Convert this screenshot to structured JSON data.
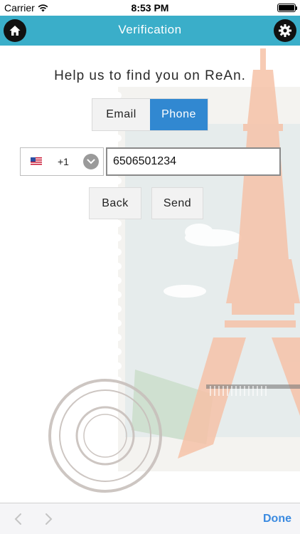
{
  "status_bar": {
    "carrier": "Carrier",
    "time": "8:53 PM",
    "battery_level": 1.0
  },
  "nav": {
    "title": "Verification",
    "left_icon": "home-icon",
    "right_icon": "gear-icon",
    "bar_color": "#3aaec9"
  },
  "main": {
    "headline": "Help us to find you on ReAn.",
    "segments": [
      {
        "label": "Email",
        "selected": false
      },
      {
        "label": "Phone",
        "selected": true
      }
    ],
    "selected_color": "#3188d1",
    "country": {
      "flag_icon": "us-flag-icon",
      "dial_code": "+1"
    },
    "phone": {
      "value": "6506501234"
    },
    "buttons": {
      "back": "Back",
      "send": "Send"
    }
  },
  "accessory_bar": {
    "prev_icon": "chevron-left-icon",
    "next_icon": "chevron-right-icon",
    "done": "Done",
    "done_color": "#3a8ae0"
  }
}
